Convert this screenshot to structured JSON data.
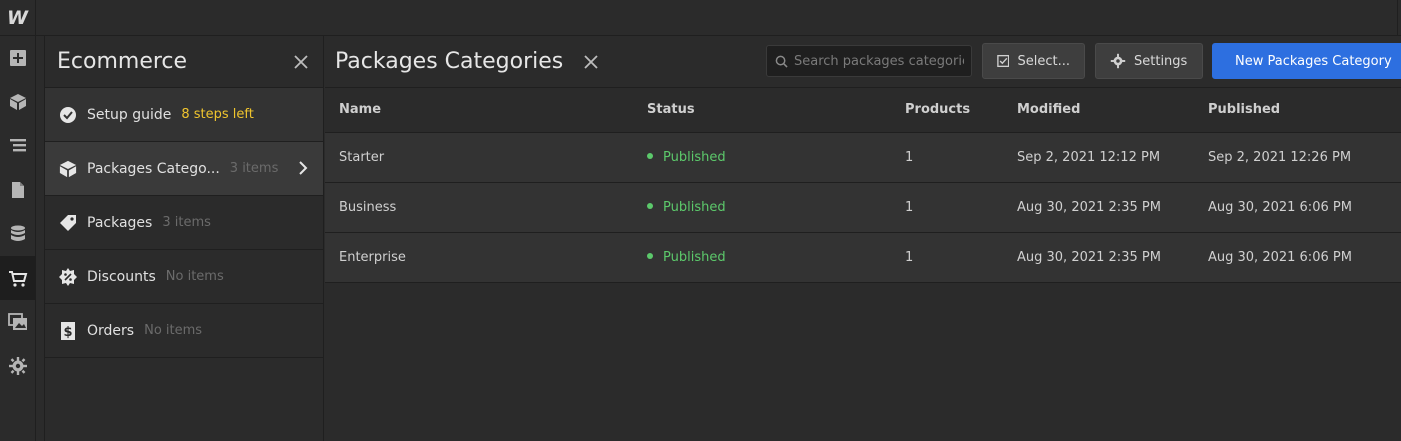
{
  "app": {
    "logo_text": "W"
  },
  "rail": {
    "items": [
      {
        "icon": "add-icon"
      },
      {
        "icon": "cube-icon"
      },
      {
        "icon": "navigator-icon"
      },
      {
        "icon": "pages-icon"
      },
      {
        "icon": "database-icon"
      },
      {
        "icon": "cart-icon"
      },
      {
        "icon": "assets-icon"
      },
      {
        "icon": "gear-icon"
      }
    ]
  },
  "panel": {
    "title": "Ecommerce",
    "setup": {
      "label": "Setup guide",
      "steps": "8 steps left"
    },
    "items": [
      {
        "label": "Packages Catego...",
        "count": "3 items"
      },
      {
        "label": "Packages",
        "count": "3 items"
      },
      {
        "label": "Discounts",
        "count": "No items"
      },
      {
        "label": "Orders",
        "count": "No items"
      }
    ]
  },
  "main": {
    "title": "Packages Categories",
    "search_placeholder": "Search packages categories",
    "select_label": "Select...",
    "settings_label": "Settings",
    "new_label": "New Packages Category",
    "columns": [
      "Name",
      "Status",
      "Products",
      "Modified",
      "Published"
    ],
    "rows": [
      {
        "name": "Starter",
        "status": "Published",
        "products": "1",
        "modified": "Sep 2, 2021 12:12 PM",
        "published": "Sep 2, 2021 12:26 PM"
      },
      {
        "name": "Business",
        "status": "Published",
        "products": "1",
        "modified": "Aug 30, 2021 2:35 PM",
        "published": "Aug 30, 2021 6:06 PM"
      },
      {
        "name": "Enterprise",
        "status": "Published",
        "products": "1",
        "modified": "Aug 30, 2021 2:35 PM",
        "published": "Aug 30, 2021 6:06 PM"
      }
    ]
  },
  "colors": {
    "accent": "#2d6fe0",
    "published": "#5cc96b",
    "steps": "#f0c52e"
  }
}
